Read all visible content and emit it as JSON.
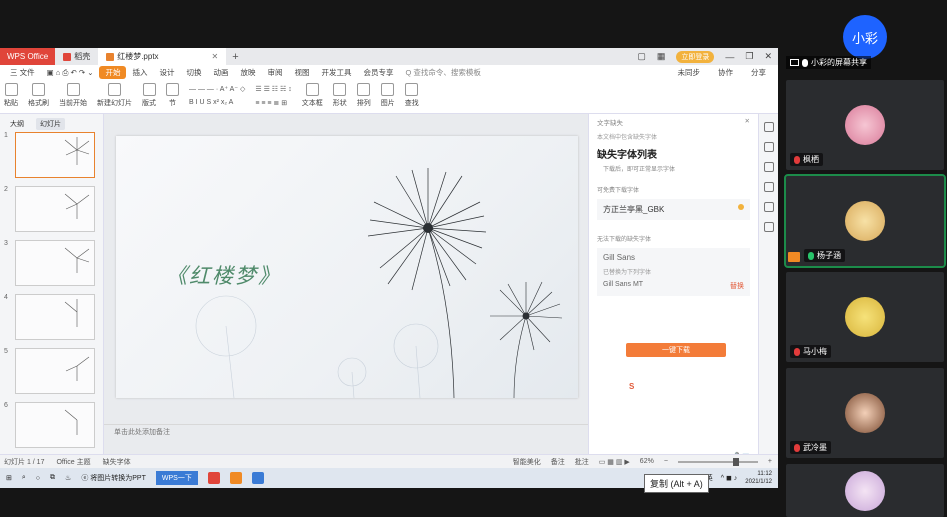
{
  "wps": {
    "tabs": {
      "home": "WPS Office",
      "second": "稻壳",
      "doc": "红楼梦.pptx"
    },
    "window": {
      "upgrade": "立即登录"
    },
    "menu": {
      "items": [
        "三 文件",
        "开始",
        "插入",
        "设计",
        "切换",
        "动画",
        "放映",
        "审阅",
        "视图",
        "开发工具",
        "会员专享"
      ],
      "search": "Q 查找命令、搜索模板",
      "right": [
        "未同步",
        "协作",
        "分享"
      ]
    },
    "ribbon": {
      "left_groups": [
        "粘贴",
        "格式刷",
        "当前开始",
        "新建幻灯片",
        "版式",
        "节"
      ],
      "text_tools": [
        "文本框",
        "形状",
        "排列",
        "图片",
        "查找"
      ]
    },
    "leftpane": {
      "tab_outline": "大纲",
      "tab_slides": "幻灯片",
      "numbers": [
        "1",
        "2",
        "3",
        "4",
        "5",
        "6"
      ]
    },
    "slide": {
      "title": "《红楼梦》"
    },
    "notes": "单击此处添加备注",
    "taskpane": {
      "header": "文字缺失",
      "subheader": "本文档中包含缺失字体",
      "title": "缺失字体列表",
      "desc": "下载后，即可正常显示字体",
      "sec1": "可免费下载字体",
      "font1": "方正兰亭黑_GBK",
      "sec2": "无法下载的缺失字体",
      "font2": "Gill Sans",
      "font2_note": "已替换为下列字体",
      "font2_replace": "Gill Sans MT",
      "font2_action": "替换",
      "download": "一键下载",
      "sogou": "S"
    },
    "ime": {
      "label": "中"
    },
    "status": {
      "left": [
        "幻灯片 1 / 17",
        "Office 主题",
        "缺失字体"
      ],
      "right": [
        "智能美化",
        "备注",
        "批注"
      ],
      "zoom": "62%"
    }
  },
  "taskbar": {
    "search_app": "将图片转换为PPT",
    "wps_label": "WPS一下",
    "ime": "英",
    "pc": "PC",
    "time": "11:12",
    "date": "2021/1/12"
  },
  "tooltip": "复制 (Alt + A)",
  "participants": [
    {
      "name": "小彩",
      "type": "initials",
      "share_label": "小彩的屏幕共享"
    },
    {
      "name": "枫栖",
      "mic": "red"
    },
    {
      "name": "杨子涵",
      "mic": "green",
      "speaking": true
    },
    {
      "name": "马小梅",
      "mic": "red"
    },
    {
      "name": "武冷墨",
      "mic": "red"
    },
    {
      "name": "",
      "mic": "none"
    }
  ],
  "colors": {
    "wps_red": "#e0453a",
    "accent_orange": "#f37c39",
    "title_green": "#4f8a6a",
    "host_blue": "#1e63ff"
  }
}
